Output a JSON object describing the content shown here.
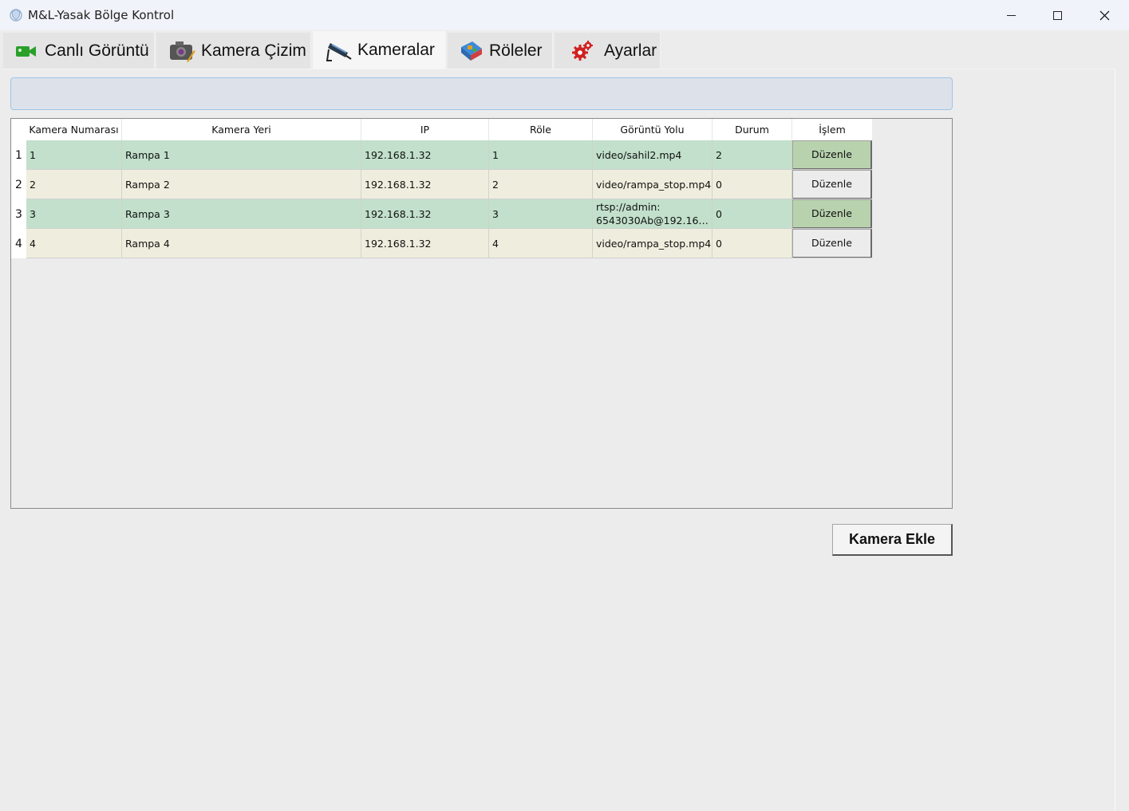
{
  "window": {
    "title": "M&L-Yasak Bölge Kontrol"
  },
  "tabs": [
    {
      "label": "Canlı Görüntü",
      "icon": "video-camera-icon"
    },
    {
      "label": "Kamera Çizim",
      "icon": "camera-draw-icon"
    },
    {
      "label": "Kameralar",
      "icon": "cctv-camera-icon",
      "active": true
    },
    {
      "label": "Röleler",
      "icon": "relay-board-icon"
    },
    {
      "label": "Ayarlar",
      "icon": "gear-icon"
    }
  ],
  "table": {
    "headers": [
      "Kamera Numarası",
      "Kamera Yeri",
      "IP",
      "Röle",
      "Görüntü Yolu",
      "Durum",
      "İşlem"
    ],
    "rows": [
      {
        "num": "1",
        "kamera_no": "1",
        "yer": "Rampa 1",
        "ip": "192.168.1.32",
        "role": "1",
        "yol": "video/sahil2.mp4",
        "yol2": "",
        "durum": "2",
        "islem": "Düzenle"
      },
      {
        "num": "2",
        "kamera_no": "2",
        "yer": "Rampa 2",
        "ip": "192.168.1.32",
        "role": "2",
        "yol": "video/rampa_stop.mp4",
        "yol2": "",
        "durum": "0",
        "islem": "Düzenle"
      },
      {
        "num": "3",
        "kamera_no": "3",
        "yer": "Rampa 3",
        "ip": "192.168.1.32",
        "role": "3",
        "yol": "rtsp://admin:",
        "yol2": "6543030Ab@192.168.1...",
        "durum": "0",
        "islem": "Düzenle"
      },
      {
        "num": "4",
        "kamera_no": "4",
        "yer": "Rampa 4",
        "ip": "192.168.1.32",
        "role": "4",
        "yol": "video/rampa_stop.mp4",
        "yol2": "",
        "durum": "0",
        "islem": "Düzenle"
      }
    ]
  },
  "actions": {
    "add_camera": "Kamera Ekle"
  },
  "colors": {
    "row_green": "#c2e0cb",
    "row_beige": "#efeede",
    "search_bg": "#dde2ea",
    "search_border": "#9ec4e6"
  }
}
